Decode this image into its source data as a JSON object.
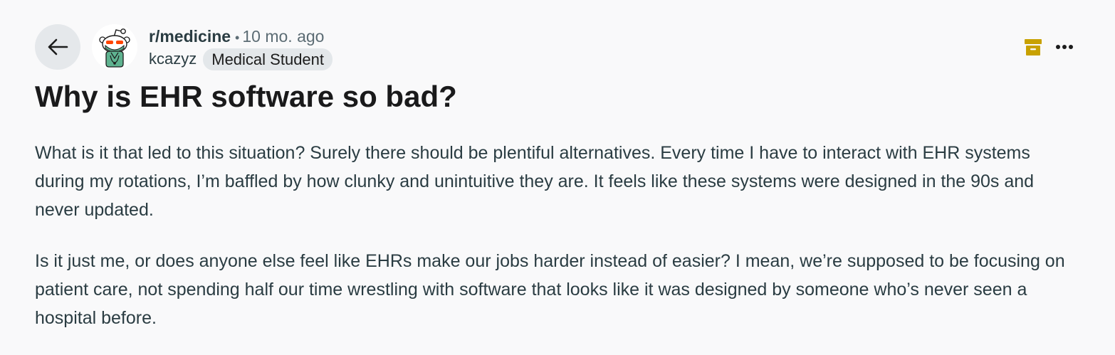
{
  "post": {
    "subreddit": "r/medicine",
    "separator": "•",
    "time_ago": "10 mo. ago",
    "author": "kcazyz",
    "flair": "Medical Student",
    "title": "Why is EHR software so bad?",
    "body": [
      "What is it that led to this situation? Surely there should be plentiful alternatives. Every time I have to interact with EHR systems during my rotations, I’m baffled by how clunky and unintuitive they are. It feels like these systems were designed in the 90s and never updated.",
      "Is it just me, or does anyone else feel like EHRs make our jobs harder instead of easier? I mean, we’re supposed to be focusing on patient care, not spending half our time wrestling with software that looks like it was designed by someone who’s never seen a hospital before."
    ]
  },
  "icons": {
    "back": "arrow-left-icon",
    "avatar": "snoo-avatar",
    "archive": "archive-icon",
    "more": "more-options-icon"
  },
  "colors": {
    "background": "#f9f9fa",
    "back_button_bg": "#e5e8eb",
    "flair_bg": "#e3e7ea",
    "archive": "#c8a100",
    "avatar_accent": "#5fb390",
    "text_secondary": "#5c6c74"
  }
}
